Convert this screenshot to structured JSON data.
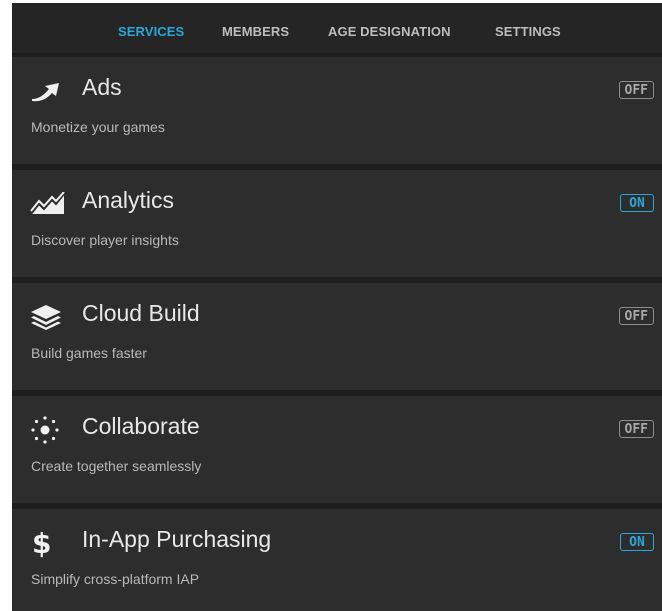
{
  "tabs": [
    {
      "label": "SERVICES",
      "active": true
    },
    {
      "label": "MEMBERS",
      "active": false
    },
    {
      "label": "AGE DESIGNATION",
      "active": false
    },
    {
      "label": "SETTINGS",
      "active": false
    }
  ],
  "services": [
    {
      "title": "Ads",
      "description": "Monetize your games",
      "status": "OFF",
      "icon": "ads-arrow-icon"
    },
    {
      "title": "Analytics",
      "description": "Discover player insights",
      "status": "ON",
      "icon": "analytics-chart-icon"
    },
    {
      "title": "Cloud Build",
      "description": "Build games faster",
      "status": "OFF",
      "icon": "cloud-build-layers-icon"
    },
    {
      "title": "Collaborate",
      "description": "Create together seamlessly",
      "status": "OFF",
      "icon": "collaborate-burst-icon"
    },
    {
      "title": "In-App Purchasing",
      "description": "Simplify cross-platform IAP",
      "status": "ON",
      "icon": "dollar-icon"
    }
  ],
  "colors": {
    "accent": "#29a8d8",
    "background": "#1e1e1e",
    "card": "#2d2d2d",
    "text": "#e8e8e8",
    "muted": "#b9b9b9"
  }
}
